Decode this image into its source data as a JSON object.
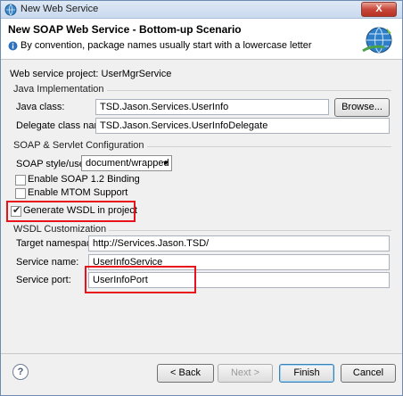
{
  "window": {
    "title": "New Web Service",
    "close_glyph": "X"
  },
  "banner": {
    "title": "New SOAP Web Service - Bottom-up Scenario",
    "message": "By convention, package names usually start with a lowercase letter",
    "message_icon": "info-icon",
    "logo_icon": "web-service-globe-icon"
  },
  "project": {
    "label": "Web service project: UserMgrService"
  },
  "java_impl": {
    "group_label": "Java Implementation",
    "java_class_label": "Java class:",
    "java_class_value": "TSD.Jason.Services.UserInfo",
    "browse_label": "Browse...",
    "delegate_label": "Delegate class name:",
    "delegate_value": "TSD.Jason.Services.UserInfoDelegate"
  },
  "soap": {
    "group_label": "SOAP & Servlet Configuration",
    "style_label": "SOAP style/use:",
    "style_value": "document/wrapped",
    "soap12_label": "Enable SOAP 1.2 Binding",
    "soap12_checked": false,
    "mtom_label": "Enable MTOM Support",
    "mtom_checked": false
  },
  "wsdl_gen": {
    "label": "Generate WSDL in project",
    "checked": true
  },
  "wsdl": {
    "group_label": "WSDL Customization",
    "namespace_label": "Target namespace:",
    "namespace_value": "http://Services.Jason.TSD/",
    "service_label": "Service name:",
    "service_value": "UserInfoService",
    "port_label": "Service port:",
    "port_value": "UserInfoPort"
  },
  "footer": {
    "help_glyph": "?",
    "back_label": "< Back",
    "next_label": "Next >",
    "finish_label": "Finish",
    "cancel_label": "Cancel"
  },
  "colors": {
    "highlight": "#e8121a",
    "banner_bg": "#ffffff",
    "dialog_bg": "#f0f0f0"
  }
}
